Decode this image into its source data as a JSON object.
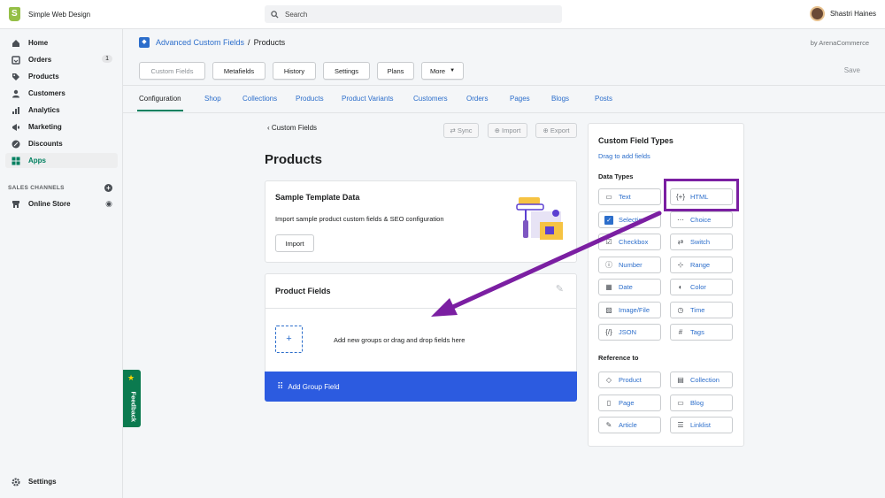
{
  "topbar": {
    "store_name": "Simple Web Design",
    "search_placeholder": "Search",
    "user_name": "Shastri Haines"
  },
  "sidebar": {
    "items": [
      {
        "label": "Home",
        "icon": "home-icon"
      },
      {
        "label": "Orders",
        "icon": "orders-icon",
        "count": "1"
      },
      {
        "label": "Products",
        "icon": "tag-icon"
      },
      {
        "label": "Customers",
        "icon": "person-icon"
      },
      {
        "label": "Analytics",
        "icon": "bar-chart-icon"
      },
      {
        "label": "Marketing",
        "icon": "megaphone-icon"
      },
      {
        "label": "Discounts",
        "icon": "discount-icon"
      },
      {
        "label": "Apps",
        "icon": "apps-icon"
      }
    ],
    "sales_channels_label": "SALES CHANNELS",
    "online_store_label": "Online Store",
    "settings_label": "Settings",
    "feedback_label": "Feedback"
  },
  "header": {
    "app_name": "Advanced Custom Fields",
    "separator": "/",
    "current_page": "Products",
    "byline": "by ArenaCommerce"
  },
  "toolbar": {
    "buttons": [
      "Custom Fields",
      "Metafields",
      "History",
      "Settings",
      "Plans",
      "More"
    ],
    "save_label": "Save"
  },
  "tabs": [
    "Configuration",
    "Shop",
    "Collections",
    "Products",
    "Product Variants",
    "Customers",
    "Orders",
    "Pages",
    "Blogs",
    "Posts"
  ],
  "content": {
    "back_label": "Custom Fields",
    "sync_label": "Sync",
    "import_label": "Import",
    "export_label": "Export",
    "page_title": "Products",
    "sample": {
      "title": "Sample Template Data",
      "description": "Import sample product custom fields & SEO configuration",
      "button": "Import"
    },
    "product_fields": {
      "title": "Product Fields",
      "empty_text": "Add new groups or drag and drop fields here",
      "add_group_label": "Add Group Field"
    }
  },
  "panel": {
    "title": "Custom Field Types",
    "subtitle": "Drag to add fields",
    "data_types_label": "Data Types",
    "data_types": [
      {
        "label": "Text",
        "icon": "text-icon"
      },
      {
        "label": "HTML",
        "icon": "html-icon"
      },
      {
        "label": "Selection",
        "icon": "checkbox-checked-icon"
      },
      {
        "label": "Choice",
        "icon": "choice-icon"
      },
      {
        "label": "Checkbox",
        "icon": "checkbox-icon"
      },
      {
        "label": "Switch",
        "icon": "switch-icon"
      },
      {
        "label": "Number",
        "icon": "number-icon"
      },
      {
        "label": "Range",
        "icon": "range-icon"
      },
      {
        "label": "Date",
        "icon": "calendar-icon"
      },
      {
        "label": "Color",
        "icon": "palette-icon"
      },
      {
        "label": "Image/File",
        "icon": "image-icon"
      },
      {
        "label": "Time",
        "icon": "clock-icon"
      },
      {
        "label": "JSON",
        "icon": "json-icon"
      },
      {
        "label": "Tags",
        "icon": "hash-icon"
      }
    ],
    "reference_label": "Reference to",
    "references": [
      {
        "label": "Product",
        "icon": "tag-icon"
      },
      {
        "label": "Collection",
        "icon": "collection-icon"
      },
      {
        "label": "Page",
        "icon": "page-icon"
      },
      {
        "label": "Blog",
        "icon": "blog-icon"
      },
      {
        "label": "Article",
        "icon": "pencil-icon"
      },
      {
        "label": "Linklist",
        "icon": "list-icon"
      }
    ]
  },
  "colors": {
    "accent": "#2c6ecb",
    "primary_button": "#2c5be0",
    "active_nav": "#008060",
    "annotation": "#7b1fa2"
  }
}
